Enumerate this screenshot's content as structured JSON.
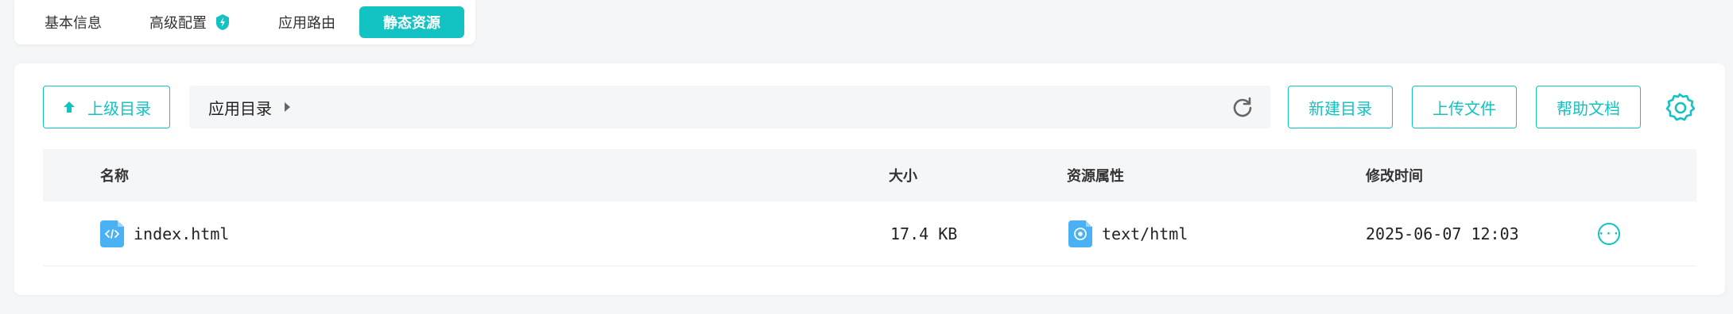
{
  "tabs": [
    {
      "label": "基本信息",
      "active": false
    },
    {
      "label": "高级配置",
      "active": false,
      "badge_icon": "shield-lightning-icon"
    },
    {
      "label": "应用路由",
      "active": false
    },
    {
      "label": "静态资源",
      "active": true
    }
  ],
  "toolbar": {
    "parent_dir_label": "上级目录",
    "path_label": "应用目录",
    "new_dir_label": "新建目录",
    "upload_label": "上传文件",
    "help_label": "帮助文档"
  },
  "table": {
    "columns": [
      "名称",
      "大小",
      "资源属性",
      "修改时间"
    ],
    "rows": [
      {
        "name": "index.html",
        "size": "17.4 KB",
        "type": "text/html",
        "modified": "2025-06-07 12:03"
      }
    ]
  },
  "colors": {
    "accent": "#13c2c2",
    "file_icon": "#4ab1f5"
  }
}
